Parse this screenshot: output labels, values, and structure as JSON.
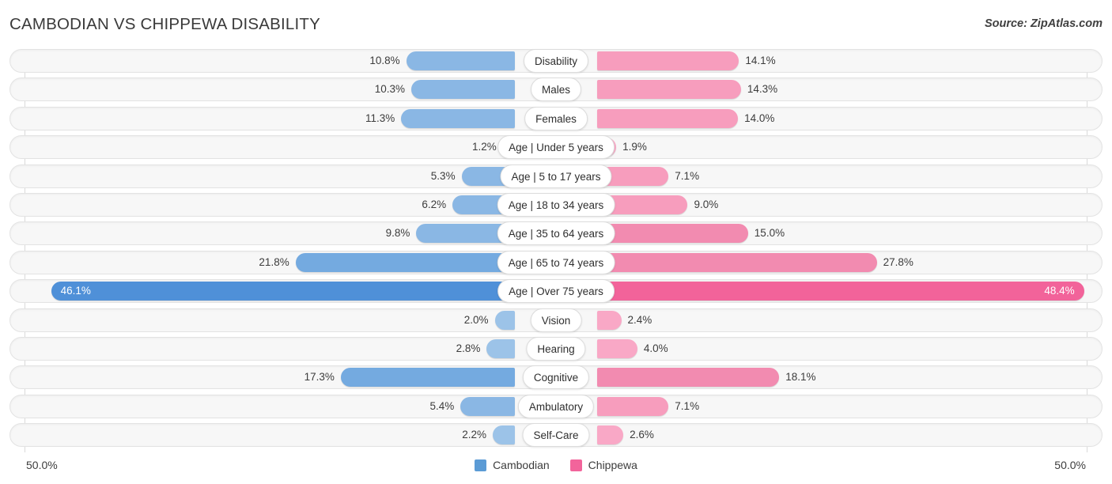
{
  "header": {
    "title": "CAMBODIAN VS CHIPPEWA DISABILITY",
    "source": "Source: ZipAtlas.com"
  },
  "axis": {
    "min_label": "50.0%",
    "max_label": "50.0%"
  },
  "legend": {
    "items": [
      {
        "label": "Cambodian",
        "color": "#5b9bd5",
        "icon": "square-swatch"
      },
      {
        "label": "Chippewa",
        "color": "#f2649b",
        "icon": "square-swatch"
      }
    ]
  },
  "colors": {
    "left_light": "#9cc3e8",
    "left_mid": "#8ab7e4",
    "left_strong": "#74aae0",
    "left_highlight": "#4f90d8",
    "right_light": "#f9a8c6",
    "right_mid": "#f79dbd",
    "right_strong": "#f28bb0",
    "right_highlight": "#f2639a",
    "track": "#f7f7f7",
    "gridline": "#d9d9d9",
    "text": "#3c3c3c"
  },
  "chart_data": {
    "type": "bar",
    "subtype": "diverging-bidirectional",
    "title": "CAMBODIAN VS CHIPPEWA DISABILITY",
    "xlabel": "",
    "ylabel": "",
    "xlim": [
      50.0,
      50.0
    ],
    "grid": true,
    "legend_position": "bottom-center",
    "unit": "%",
    "categories": [
      "Disability",
      "Males",
      "Females",
      "Age | Under 5 years",
      "Age | 5 to 17 years",
      "Age | 18 to 34 years",
      "Age | 35 to 64 years",
      "Age | 65 to 74 years",
      "Age | Over 75 years",
      "Vision",
      "Hearing",
      "Cognitive",
      "Ambulatory",
      "Self-Care"
    ],
    "series": [
      {
        "name": "Cambodian",
        "color": "#5b9bd5",
        "side": "left",
        "values": [
          10.8,
          10.3,
          11.3,
          1.2,
          5.3,
          6.2,
          9.8,
          21.8,
          46.1,
          2.0,
          2.8,
          17.3,
          5.4,
          2.2
        ]
      },
      {
        "name": "Chippewa",
        "color": "#f2649b",
        "side": "right",
        "values": [
          14.1,
          14.3,
          14.0,
          1.9,
          7.1,
          9.0,
          15.0,
          27.8,
          48.4,
          2.4,
          4.0,
          18.1,
          7.1,
          2.6
        ]
      }
    ]
  },
  "rows": [
    {
      "label": "Disability",
      "left_value": "10.8%",
      "right_value": "14.1%",
      "left_num": 10.8,
      "right_num": 14.1,
      "highlight": false
    },
    {
      "label": "Males",
      "left_value": "10.3%",
      "right_value": "14.3%",
      "left_num": 10.3,
      "right_num": 14.3,
      "highlight": false
    },
    {
      "label": "Females",
      "left_value": "11.3%",
      "right_value": "14.0%",
      "left_num": 11.3,
      "right_num": 14.0,
      "highlight": false
    },
    {
      "label": "Age | Under 5 years",
      "left_value": "1.2%",
      "right_value": "1.9%",
      "left_num": 1.2,
      "right_num": 1.9,
      "highlight": false
    },
    {
      "label": "Age | 5 to 17 years",
      "left_value": "5.3%",
      "right_value": "7.1%",
      "left_num": 5.3,
      "right_num": 7.1,
      "highlight": false
    },
    {
      "label": "Age | 18 to 34 years",
      "left_value": "6.2%",
      "right_value": "9.0%",
      "left_num": 6.2,
      "right_num": 9.0,
      "highlight": false
    },
    {
      "label": "Age | 35 to 64 years",
      "left_value": "9.8%",
      "right_value": "15.0%",
      "left_num": 9.8,
      "right_num": 15.0,
      "highlight": false
    },
    {
      "label": "Age | 65 to 74 years",
      "left_value": "21.8%",
      "right_value": "27.8%",
      "left_num": 21.8,
      "right_num": 27.8,
      "highlight": false
    },
    {
      "label": "Age | Over 75 years",
      "left_value": "46.1%",
      "right_value": "48.4%",
      "left_num": 46.1,
      "right_num": 48.4,
      "highlight": true
    },
    {
      "label": "Vision",
      "left_value": "2.0%",
      "right_value": "2.4%",
      "left_num": 2.0,
      "right_num": 2.4,
      "highlight": false
    },
    {
      "label": "Hearing",
      "left_value": "2.8%",
      "right_value": "4.0%",
      "left_num": 2.8,
      "right_num": 4.0,
      "highlight": false
    },
    {
      "label": "Cognitive",
      "left_value": "17.3%",
      "right_value": "18.1%",
      "left_num": 17.3,
      "right_num": 18.1,
      "highlight": false
    },
    {
      "label": "Ambulatory",
      "left_value": "5.4%",
      "right_value": "7.1%",
      "left_num": 5.4,
      "right_num": 7.1,
      "highlight": false
    },
    {
      "label": "Self-Care",
      "left_value": "2.2%",
      "right_value": "2.6%",
      "left_num": 2.2,
      "right_num": 2.6,
      "highlight": false
    }
  ]
}
